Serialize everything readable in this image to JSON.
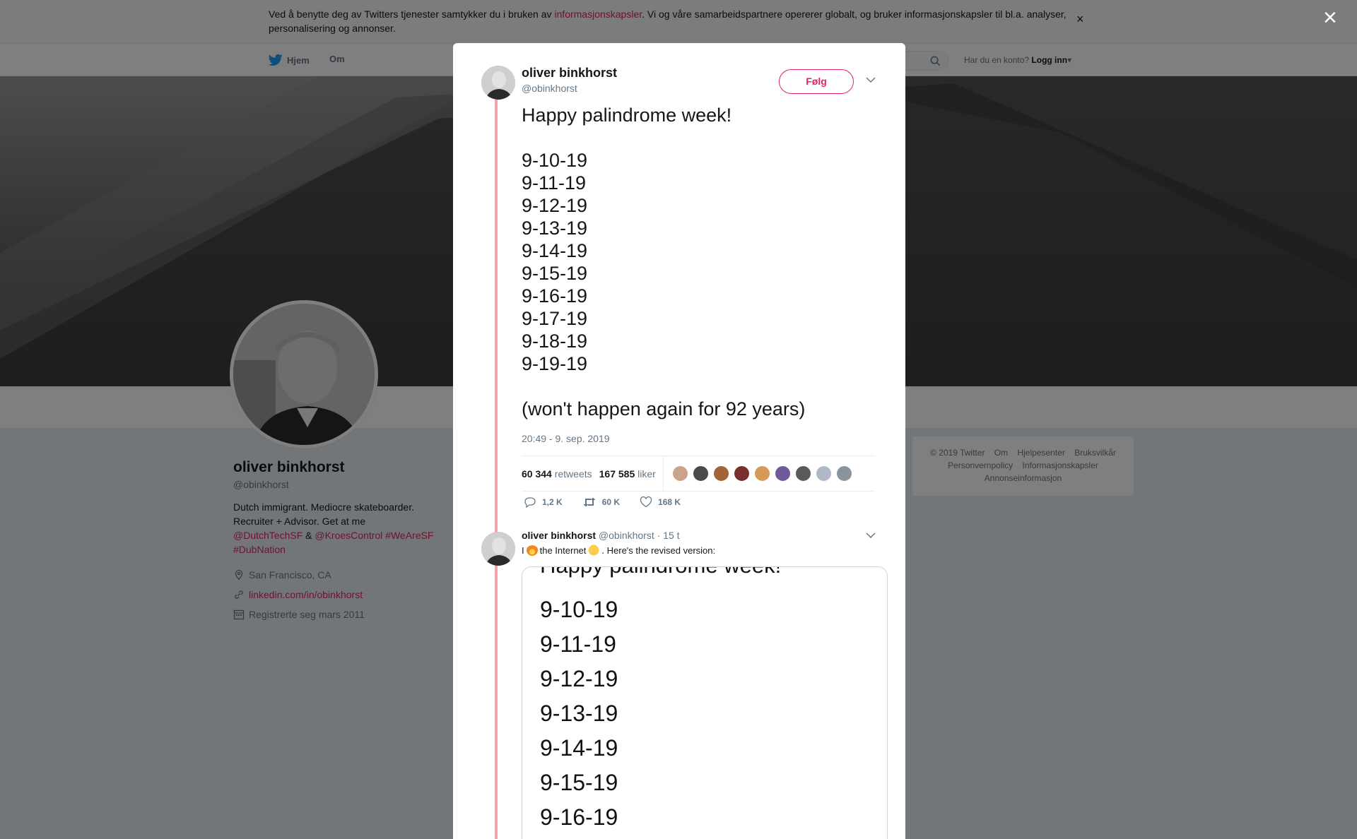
{
  "cookie_banner": {
    "text_before": "Ved å benytte deg av Twitters tjenester samtykker du i bruken av ",
    "link": "informasjonskapsler",
    "text_after": ". Vi og våre samarbeidspartnere opererer globalt, og bruker informasjonskapsler til bl.a. analyser, personalisering og annonser.",
    "close": "×"
  },
  "nav": {
    "home": "Hjem",
    "about": "Om",
    "login_prompt": "Har du en konto?",
    "login": "Logg inn"
  },
  "profile": {
    "name": "oliver binkhorst",
    "handle": "@obinkhorst",
    "bio_plain": "Dutch immigrant. Mediocre skateboarder. Recruiter + Advisor. Get at me",
    "bio_mention1": "@DutchTechSF",
    "bio_amp": "&",
    "bio_mention2": "@KroesControl",
    "bio_tag1": "#WeAreSF",
    "bio_tag2": "#DubNation",
    "location": "San Francisco, CA",
    "url": "linkedin.com/in/obinkhorst",
    "joined": "Registrerte seg mars 2011"
  },
  "footer": {
    "copyright": "© 2019 Twitter",
    "links": [
      "Om",
      "Hjelpesenter",
      "Bruksvilkår",
      "Personvernpolicy",
      "Informasjonskapsler",
      "Annonseinformasjon"
    ]
  },
  "modal": {
    "close": "×",
    "author_name": "oliver binkhorst",
    "author_handle": "@obinkhorst",
    "follow": "Følg",
    "tweet_lines": [
      "Happy palindrome week!",
      "",
      "9-10-19",
      "9-11-19",
      "9-12-19",
      "9-13-19",
      "9-14-19",
      "9-15-19",
      "9-16-19",
      "9-17-19",
      "9-18-19",
      "9-19-19",
      "",
      "(won't happen again for 92 years)"
    ],
    "timestamp": "20:49 - 9. sep. 2019",
    "retweets_count": "60 344",
    "retweets_label": "retweets",
    "likes_count": "167 585",
    "likes_label": "liker",
    "liker_colors": [
      "#c9a38a",
      "#4a4a4a",
      "#a0663a",
      "#7a2f2f",
      "#d49a5a",
      "#6d5a9a",
      "#5a5a5a",
      "#b0b8c8",
      "#8a949e"
    ],
    "replies_count": "1,2 K",
    "retweet_action_count": "60 K",
    "like_action_count": "168 K",
    "reply": {
      "name": "oliver binkhorst",
      "handle": "@obinkhorst",
      "time": "· 15 t",
      "text_1": "I",
      "text_2": "the Internet",
      "text_3": ". Here's the revised version:",
      "media_title": "Happy palindrome week!",
      "media_dates": [
        "9-10-19",
        "9-11-19",
        "9-12-19",
        "9-13-19",
        "9-14-19",
        "9-15-19",
        "9-16-19"
      ]
    }
  },
  "colors": {
    "accent": "#e0245e",
    "thread_line": "#f4a3aa",
    "muted": "#657786",
    "twitter_blue": "#1da1f2"
  }
}
